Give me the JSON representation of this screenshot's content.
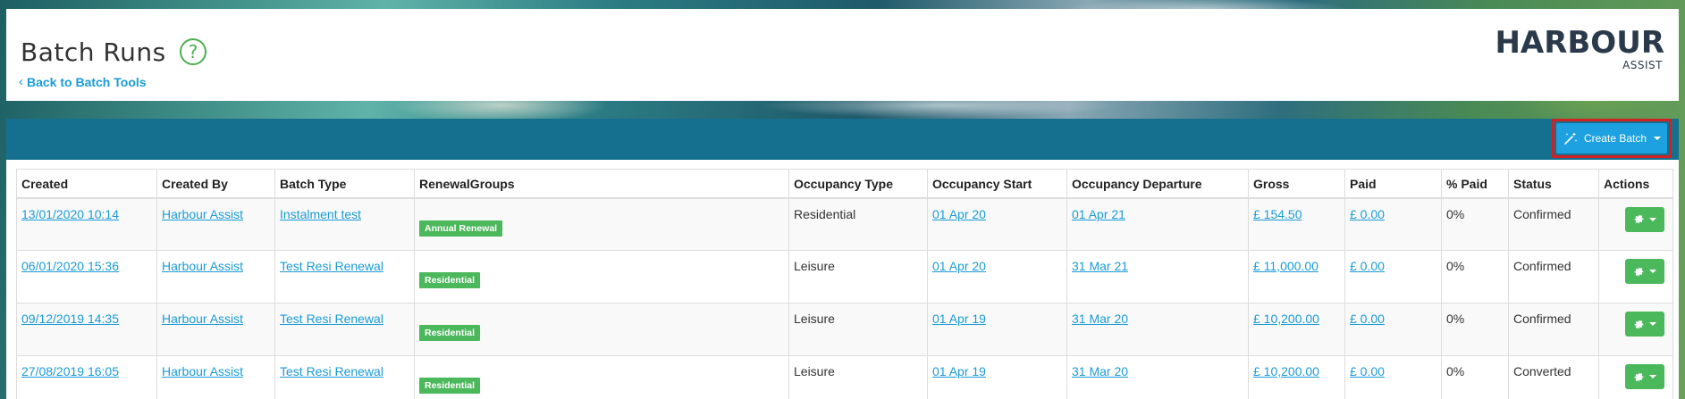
{
  "header": {
    "title": "Batch Runs",
    "help_glyph": "?",
    "back_link": "Back to Batch Tools",
    "logo_main": "HARBOUR",
    "logo_sub": "ASSIST"
  },
  "toolbar": {
    "create_batch_label": "Create Batch"
  },
  "table": {
    "columns": [
      "Created",
      "Created By",
      "Batch Type",
      "RenewalGroups",
      "Occupancy Type",
      "Occupancy Start",
      "Occupancy Departure",
      "Gross",
      "Paid",
      "% Paid",
      "Status",
      "Actions"
    ],
    "rows": [
      {
        "created": "13/01/2020 10:14",
        "created_by": "Harbour Assist",
        "batch_type": "Instalment test",
        "renewal_group": "Annual Renewal",
        "occupancy_type": "Residential",
        "start": "01 Apr 20",
        "departure": "01 Apr 21",
        "gross": "£ 154.50",
        "paid": "£ 0.00",
        "pct_paid": "0%",
        "status": "Confirmed"
      },
      {
        "created": "06/01/2020 15:36",
        "created_by": "Harbour Assist",
        "batch_type": "Test Resi Renewal",
        "renewal_group": "Residential",
        "occupancy_type": "Leisure",
        "start": "01 Apr 20",
        "departure": "31 Mar 21",
        "gross": "£ 11,000.00",
        "paid": "£ 0.00",
        "pct_paid": "0%",
        "status": "Confirmed"
      },
      {
        "created": "09/12/2019 14:35",
        "created_by": "Harbour Assist",
        "batch_type": "Test Resi Renewal",
        "renewal_group": "Residential",
        "occupancy_type": "Leisure",
        "start": "01 Apr 19",
        "departure": "31 Mar 20",
        "gross": "£ 10,200.00",
        "paid": "£ 0.00",
        "pct_paid": "0%",
        "status": "Confirmed"
      },
      {
        "created": "27/08/2019 16:05",
        "created_by": "Harbour Assist",
        "batch_type": "Test Resi Renewal",
        "renewal_group": "Residential",
        "occupancy_type": "Leisure",
        "start": "01 Apr 19",
        "departure": "31 Mar 20",
        "gross": "£ 10,200.00",
        "paid": "£ 0.00",
        "pct_paid": "0%",
        "status": "Converted"
      }
    ]
  },
  "colors": {
    "toolbar_bg": "#15708f",
    "primary_button": "#1da1e0",
    "success": "#4cb85c",
    "link": "#1a9bd7",
    "highlight_border": "#d42020"
  },
  "icons": {
    "help": "question-circle-icon",
    "back": "chevron-left-icon",
    "create": "magic-wand-icon",
    "action": "gear-icon"
  }
}
